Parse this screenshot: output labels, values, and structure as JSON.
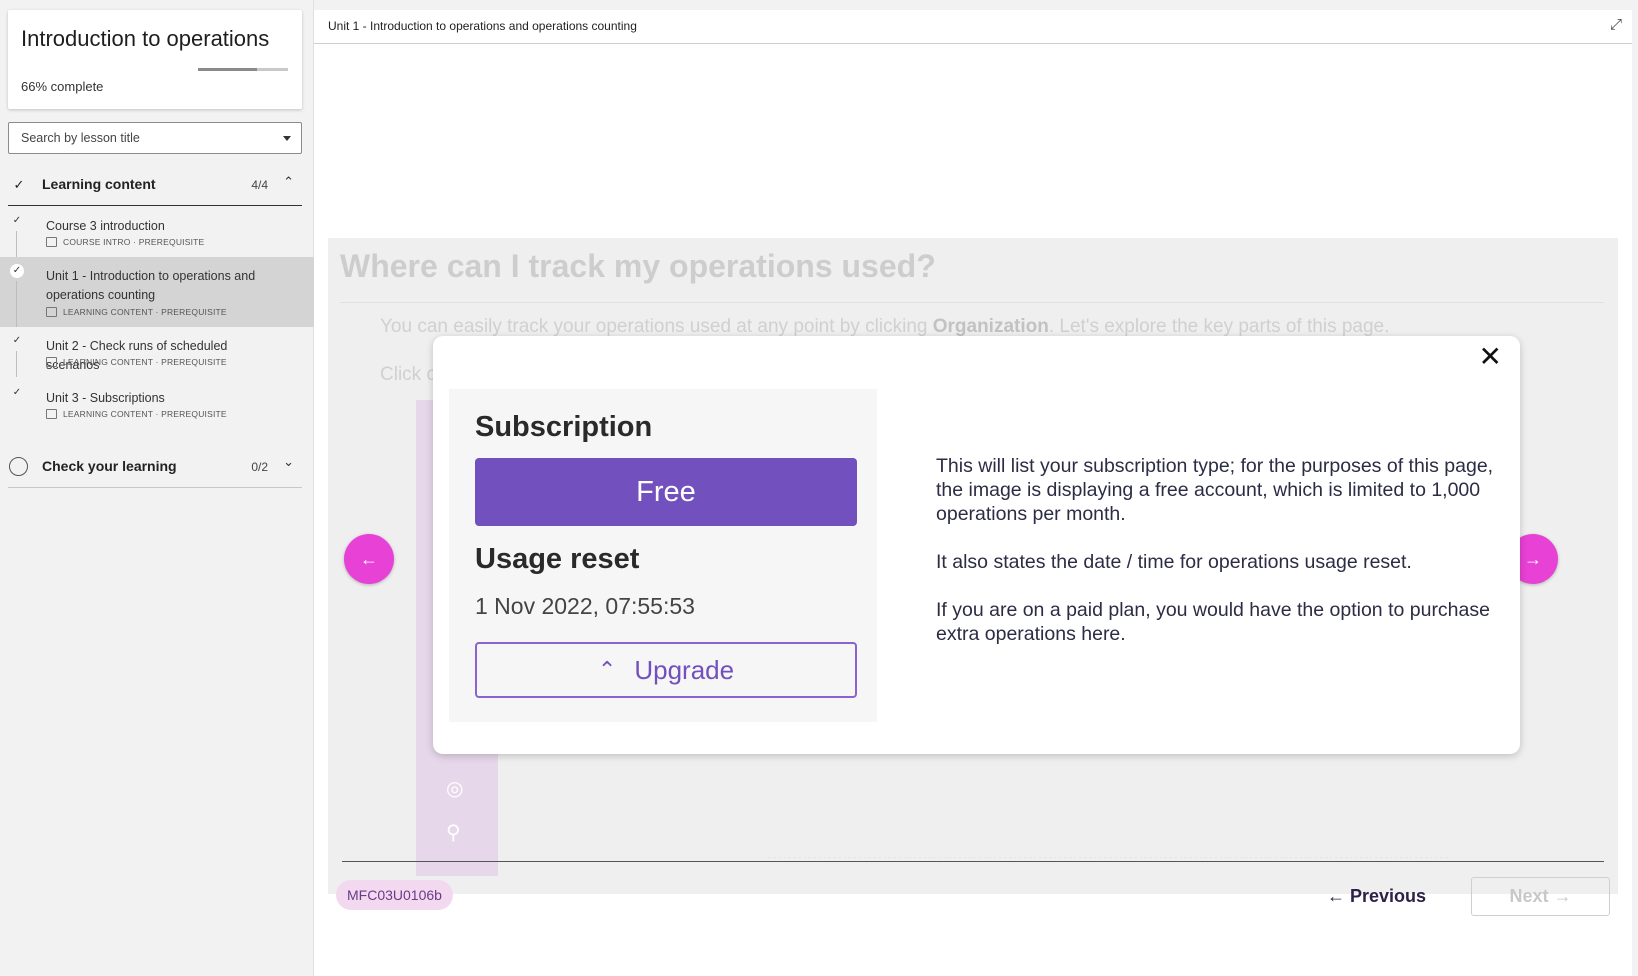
{
  "sidebar": {
    "course_title": "Introduction to operations",
    "progress_percent": "66%",
    "progress_suffix": "complete",
    "progress_fraction": 0.66,
    "search_placeholder": "Search by lesson title",
    "sections": [
      {
        "label": "Learning content",
        "count": "4/4",
        "complete": true,
        "expanded": true,
        "lessons": [
          {
            "title": "Course 3 introduction",
            "meta": "COURSE INTRO · PREREQUISITE",
            "complete": true
          },
          {
            "title": "Unit 1 - Introduction to operations and operations counting",
            "meta": "LEARNING CONTENT · PREREQUISITE",
            "complete": true,
            "active": true
          },
          {
            "title": "Unit 2 - Check runs of scheduled scenarios",
            "meta": "LEARNING CONTENT · PREREQUISITE",
            "complete": true
          },
          {
            "title": "Unit 3 - Subscriptions",
            "meta": "LEARNING CONTENT · PREREQUISITE",
            "complete": true
          }
        ]
      },
      {
        "label": "Check your learning",
        "count": "0/2",
        "complete": false,
        "expanded": false
      }
    ]
  },
  "main": {
    "breadcrumb": "Unit 1 - Introduction to operations and operations counting",
    "heading": "Where can I track my operations used?",
    "para_prefix": "You can easily track your operations used at any point by clicking ",
    "para_bold": "Organization",
    "para_suffix": ". Let's explore the key parts of this page.",
    "click_text": "Click on"
  },
  "modal": {
    "subscription_title": "Subscription",
    "plan": "Free",
    "usage_title": "Usage reset",
    "usage_date": "1 Nov 2022, 07:55:53",
    "upgrade_label": "Upgrade",
    "paragraphs": [
      "This will list your subscription type; for the purposes of this page, the image is displaying a free account, which is limited to 1,000 operations per month.",
      "It also states the date / time for operations usage reset.",
      "If you are on a paid plan, you would have the option to purchase extra operations here."
    ]
  },
  "footer": {
    "code": "MFC03U0106b",
    "previous_label": "Previous",
    "next_label": "Next"
  },
  "icons": {
    "check": "✓",
    "chevron_up": "⌃",
    "chevron_down": "⌄",
    "arrow_left": "←",
    "arrow_right": "→",
    "close": "✕",
    "expand": "⤢"
  },
  "colors": {
    "accent_magenta": "#e841d5",
    "plan_purple": "#7250bd",
    "code_pill_bg": "#f3d9f0"
  }
}
